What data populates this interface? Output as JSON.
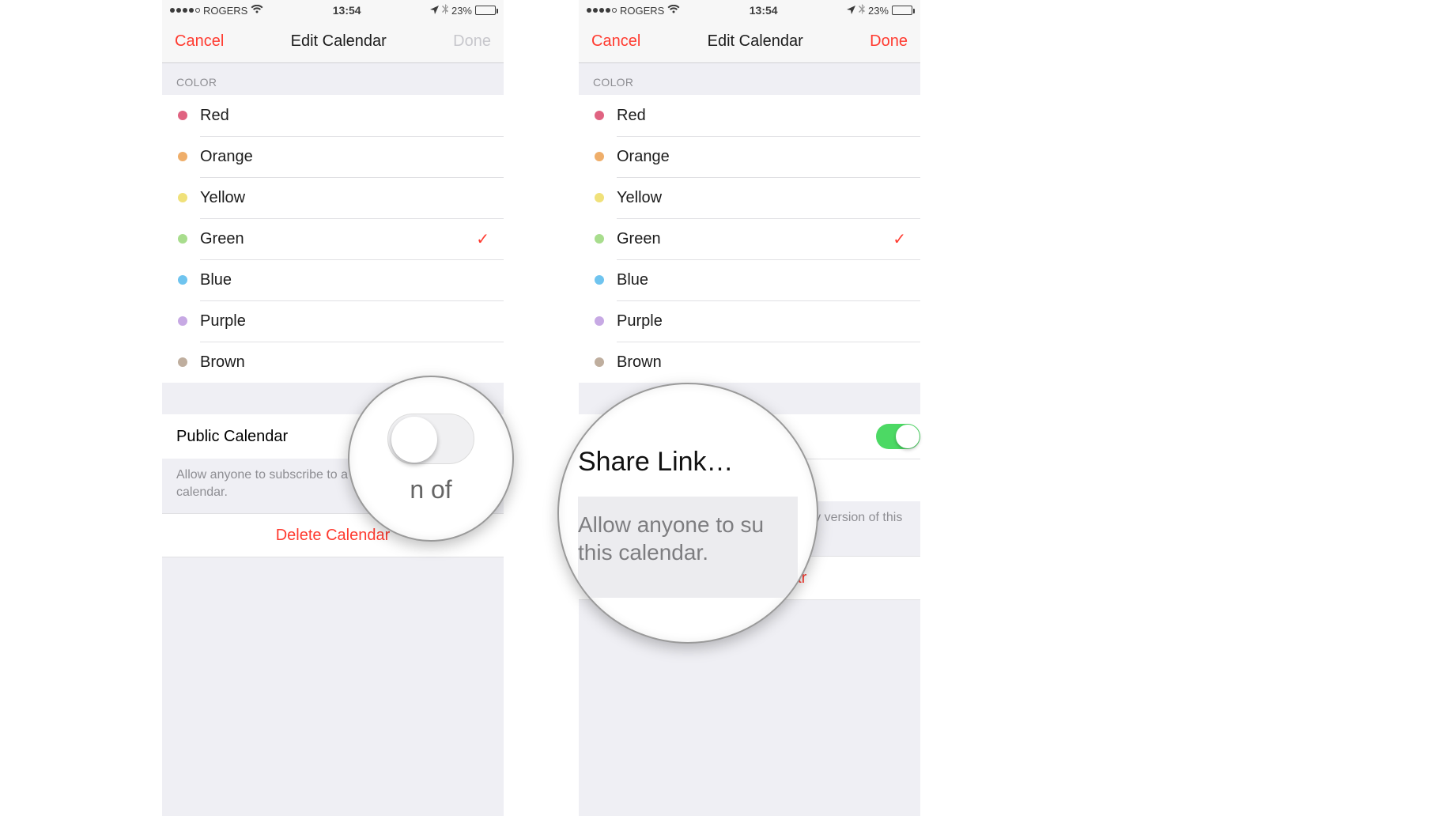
{
  "status": {
    "carrier": "ROGERS",
    "time": "13:54",
    "battery_pct": "23%"
  },
  "nav": {
    "cancel": "Cancel",
    "title": "Edit Calendar",
    "done": "Done"
  },
  "color_section_header": "COLOR",
  "colors": [
    {
      "label": "Red",
      "hex": "#e06381"
    },
    {
      "label": "Orange",
      "hex": "#efae6a"
    },
    {
      "label": "Yellow",
      "hex": "#f0e17a"
    },
    {
      "label": "Green",
      "hex": "#a8dd8d"
    },
    {
      "label": "Blue",
      "hex": "#6fc4ef"
    },
    {
      "label": "Purple",
      "hex": "#c7a9e4"
    },
    {
      "label": "Brown",
      "hex": "#bfae9e"
    }
  ],
  "selected_color_index": 3,
  "public": {
    "label": "Public Calendar",
    "share_link": "Share Link…",
    "footer_left": "Allow anyone to subscribe to a read-only version of this calendar.",
    "footer_right": "Allow anyone to subscribe to a read-only version of this calendar."
  },
  "delete_label": "Delete Calendar",
  "lens": {
    "one_sub": "n of",
    "two_line1": "Share Link…",
    "two_line2": "Allow anyone to su",
    "two_line3": "this calendar."
  }
}
